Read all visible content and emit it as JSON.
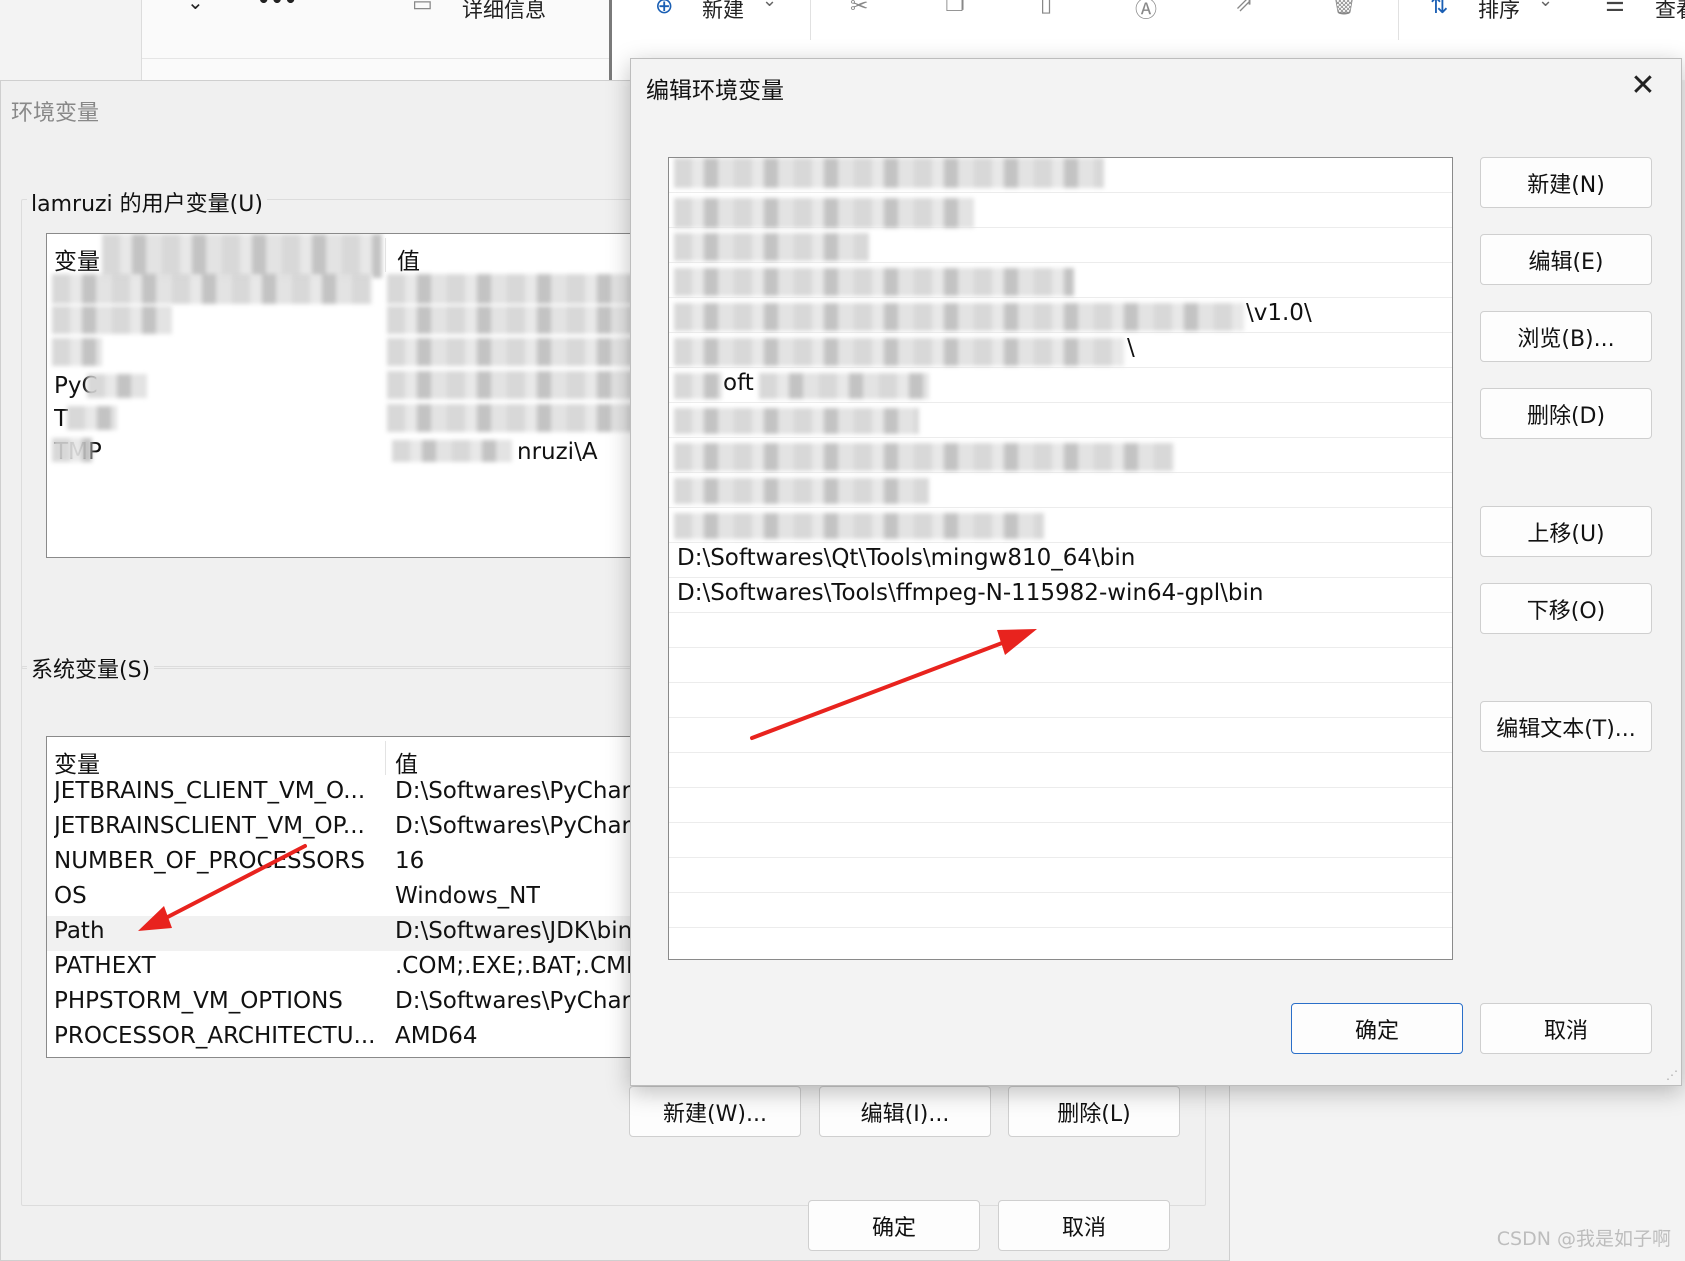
{
  "explorer_toolbar": {
    "view_label": "看",
    "more_label": "•••",
    "details_label": "详细信息",
    "new_label": "新建",
    "sort_label": "排序",
    "look_label": "查看"
  },
  "env_dialog": {
    "title": "环境变量",
    "user_group_label": "lamruzi 的用户变量(U)",
    "user_list": {
      "col_var": "变量",
      "col_val": "值",
      "visible_fragments": [
        "PyC",
        "T",
        "TMP",
        "nruzi\\A"
      ]
    },
    "system_group_label": "系统变量(S)",
    "system_list": {
      "col_var": "变量",
      "col_val": "值",
      "rows": [
        {
          "var": "JETBRAINS_CLIENT_VM_O...",
          "val": "D:\\Softwares\\PyChar"
        },
        {
          "var": "JETBRAINSCLIENT_VM_OP...",
          "val": "D:\\Softwares\\PyChar"
        },
        {
          "var": "NUMBER_OF_PROCESSORS",
          "val": "16"
        },
        {
          "var": "OS",
          "val": "Windows_NT"
        },
        {
          "var": "Path",
          "val": "D:\\Softwares\\JDK\\bin"
        },
        {
          "var": "PATHEXT",
          "val": ".COM;.EXE;.BAT;.CMD"
        },
        {
          "var": "PHPSTORM_VM_OPTIONS",
          "val": "D:\\Softwares\\PyChar"
        },
        {
          "var": "PROCESSOR_ARCHITECTU...",
          "val": "AMD64"
        }
      ]
    },
    "buttons": {
      "new": "新建(W)...",
      "edit": "编辑(I)...",
      "delete": "删除(L)",
      "ok": "确定",
      "cancel": "取消"
    }
  },
  "edit_dialog": {
    "title": "编辑环境变量",
    "close_icon": "close-icon",
    "path_fragments": {
      "row6": "\\v1.0\\",
      "row7": "\\",
      "row8": "oft"
    },
    "paths": [
      "D:\\Softwares\\Qt\\Tools\\mingw810_64\\bin",
      "D:\\Softwares\\Tools\\ffmpeg-N-115982-win64-gpl\\bin"
    ],
    "buttons": {
      "new": "新建(N)",
      "edit": "编辑(E)",
      "browse": "浏览(B)...",
      "delete": "删除(D)",
      "move_up": "上移(U)",
      "move_down": "下移(O)",
      "edit_text": "编辑文本(T)...",
      "ok": "确定",
      "cancel": "取消"
    }
  },
  "annotation_color": "#e8231e",
  "watermark": "CSDN @我是如子啊"
}
